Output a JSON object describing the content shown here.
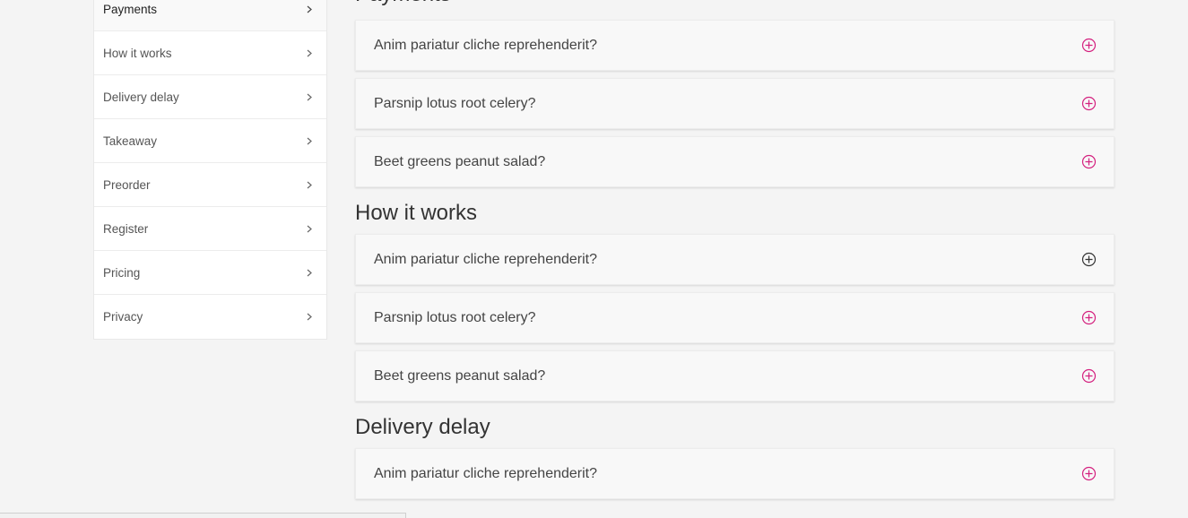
{
  "sidebar": {
    "items": [
      {
        "label": "Payments",
        "active": true
      },
      {
        "label": "How it works"
      },
      {
        "label": "Delivery delay"
      },
      {
        "label": "Takeaway"
      },
      {
        "label": "Preorder"
      },
      {
        "label": "Register"
      },
      {
        "label": "Pricing"
      },
      {
        "label": "Privacy"
      }
    ]
  },
  "sections": [
    {
      "title": "Payments",
      "questions": [
        "Anim pariatur cliche reprehenderit?",
        "Parsnip lotus root celery?",
        "Beet greens peanut salad?"
      ]
    },
    {
      "title": "How it works",
      "questions": [
        "Anim pariatur cliche reprehenderit?",
        "Parsnip lotus root celery?",
        "Beet greens peanut salad?"
      ]
    },
    {
      "title": "Delivery delay",
      "questions": [
        "Anim pariatur cliche reprehenderit?"
      ]
    }
  ],
  "colors": {
    "accent": "#d4217f",
    "icon_dark": "#333333"
  },
  "icons": {
    "sidebar_chevron": "chevron-right-icon",
    "faq_toggle": "plus-circle-icon"
  }
}
